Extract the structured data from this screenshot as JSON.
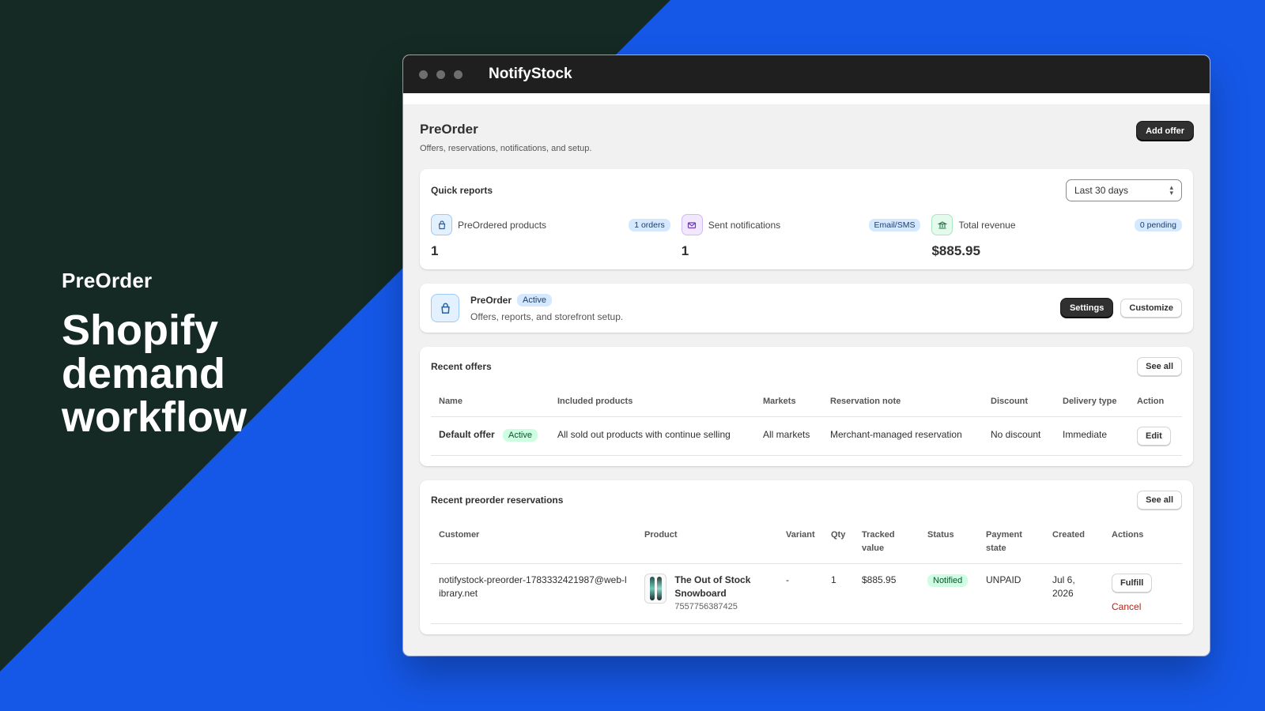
{
  "hero": {
    "kicker": "PreOrder",
    "title": "Shopify demand workflow"
  },
  "window": {
    "app_name": "NotifyStock"
  },
  "page": {
    "title": "PreOrder",
    "subtitle": "Offers, reservations, notifications, and setup.",
    "add_offer_label": "Add offer"
  },
  "quick_reports": {
    "title": "Quick reports",
    "range_value": "Last 30 days",
    "metrics": [
      {
        "icon": "shopping-bag-icon",
        "label": "PreOrdered products",
        "badge": "1 orders",
        "value": "1"
      },
      {
        "icon": "envelope-icon",
        "label": "Sent notifications",
        "badge": "Email/SMS",
        "value": "1"
      },
      {
        "icon": "bank-icon",
        "label": "Total revenue",
        "badge": "0 pending",
        "value": "$885.95"
      }
    ]
  },
  "app_status": {
    "name": "PreOrder",
    "status": "Active",
    "description": "Offers, reports, and storefront setup.",
    "settings_label": "Settings",
    "customize_label": "Customize"
  },
  "recent_offers": {
    "title": "Recent offers",
    "see_all_label": "See all",
    "columns": [
      "Name",
      "Included products",
      "Markets",
      "Reservation note",
      "Discount",
      "Delivery type",
      "Action"
    ],
    "rows": [
      {
        "name": "Default offer",
        "status": "Active",
        "included_products": "All sold out products with continue selling",
        "markets": "All markets",
        "reservation_note": "Merchant-managed reservation",
        "discount": "No discount",
        "delivery_type": "Immediate",
        "action_label": "Edit"
      }
    ]
  },
  "reservations": {
    "title": "Recent preorder reservations",
    "see_all_label": "See all",
    "columns": [
      "Customer",
      "Product",
      "Variant",
      "Qty",
      "Tracked value",
      "Status",
      "Payment state",
      "Created",
      "Actions"
    ],
    "rows": [
      {
        "customer": "notifystock-preorder-1783332421987@web-library.net",
        "product_name": "The Out of Stock Snowboard",
        "product_id": "7557756387425",
        "variant": "-",
        "qty": "1",
        "tracked_value": "$885.95",
        "status": "Notified",
        "payment_state": "UNPAID",
        "created": "Jul 6, 2026",
        "fulfill_label": "Fulfill",
        "cancel_label": "Cancel"
      }
    ]
  }
}
